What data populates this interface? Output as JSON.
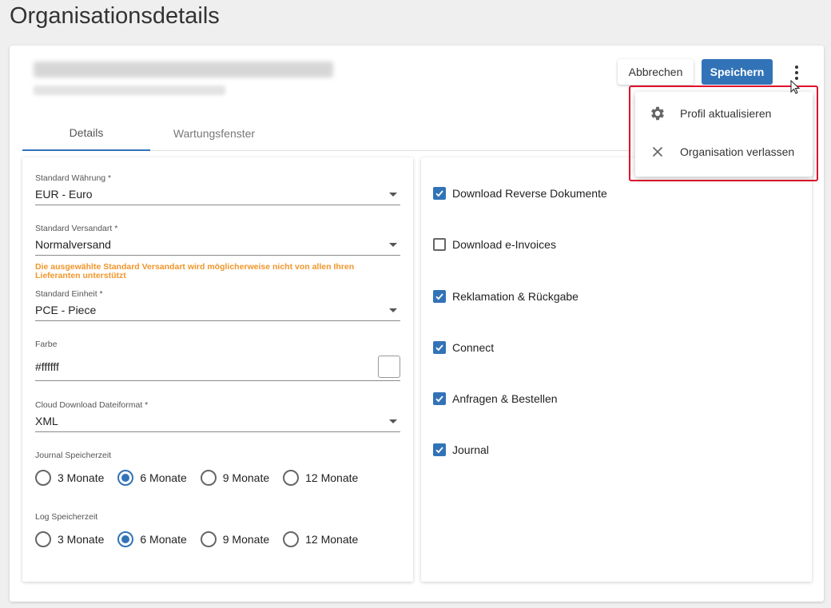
{
  "page": {
    "title": "Organisationsdetails"
  },
  "header": {
    "cancel_label": "Abbrechen",
    "save_label": "Speichern"
  },
  "tabs": [
    {
      "label": "Details",
      "active": true
    },
    {
      "label": "Wartungsfenster",
      "active": false
    }
  ],
  "form": {
    "currency": {
      "label": "Standard Währung *",
      "value": "EUR - Euro"
    },
    "shipping": {
      "label": "Standard Versandart *",
      "value": "Normalversand",
      "hint": "Die ausgewählte Standard Versandart wird möglicherweise nicht von allen Ihren Lieferanten unterstützt"
    },
    "unit": {
      "label": "Standard Einheit *",
      "value": "PCE - Piece"
    },
    "color": {
      "label": "Farbe",
      "value": "#ffffff"
    },
    "cloud_format": {
      "label": "Cloud Download Dateiformat *",
      "value": "XML"
    },
    "journal_retention": {
      "label": "Journal Speicherzeit",
      "options": [
        "3 Monate",
        "6 Monate",
        "9 Monate",
        "12 Monate"
      ],
      "selected": "6 Monate"
    },
    "log_retention": {
      "label": "Log Speicherzeit",
      "options": [
        "3 Monate",
        "6 Monate",
        "9 Monate",
        "12 Monate"
      ],
      "selected": "6 Monate"
    }
  },
  "features": [
    {
      "label": "Download Reverse Dokumente",
      "checked": true
    },
    {
      "label": "Download e-Invoices",
      "checked": false
    },
    {
      "label": "Reklamation & Rückgabe",
      "checked": true
    },
    {
      "label": "Connect",
      "checked": true
    },
    {
      "label": "Anfragen & Bestellen",
      "checked": true
    },
    {
      "label": "Journal",
      "checked": true
    }
  ],
  "more_menu": {
    "items": [
      {
        "label": "Profil aktualisieren",
        "icon": "gear-icon"
      },
      {
        "label": "Organisation verlassen",
        "icon": "close-icon"
      }
    ]
  },
  "colors": {
    "primary": "#3273b7",
    "warning": "#f0962a",
    "highlight": "#e0102d"
  }
}
